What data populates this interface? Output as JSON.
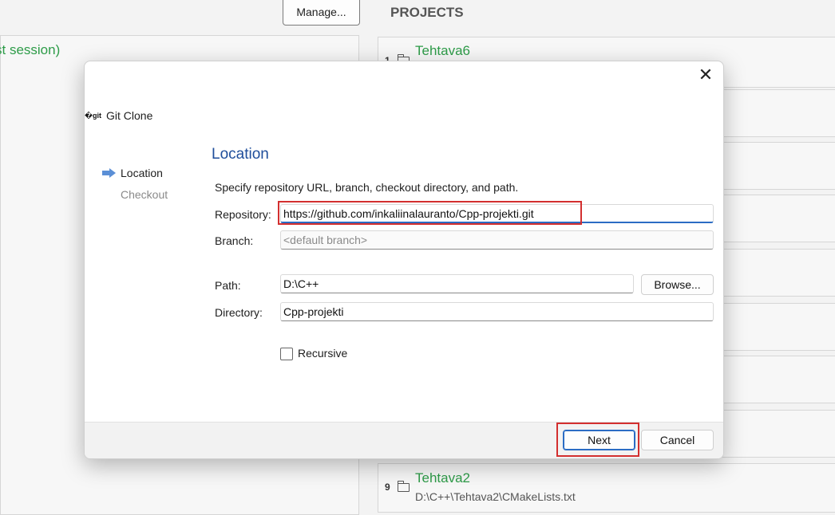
{
  "background": {
    "manage_button": "Manage...",
    "projects_heading": "PROJECTS",
    "session_text": "st session)",
    "projects": [
      {
        "number": "1",
        "name": "Tehtava6",
        "path": ""
      },
      {
        "number": "9",
        "name": "Tehtava2",
        "path": "D:\\C++\\Tehtava2\\CMakeLists.txt"
      }
    ]
  },
  "dialog": {
    "close_glyph": "✕",
    "git_icon_text": "\u0000git",
    "title": "Git Clone",
    "steps": [
      {
        "label": "Location",
        "active": true
      },
      {
        "label": "Checkout",
        "active": false
      }
    ],
    "page_heading": "Location",
    "description": "Specify repository URL, branch, checkout directory, and path.",
    "repository": {
      "label": "Repository:",
      "value": "https://github.com/inkaliinalauranto/Cpp-projekti.git"
    },
    "branch": {
      "label": "Branch:",
      "value": "",
      "placeholder": "<default branch>"
    },
    "path": {
      "label": "Path:",
      "value": "D:\\C++"
    },
    "browse_button": "Browse...",
    "directory": {
      "label": "Directory:",
      "value": "Cpp-projekti"
    },
    "recursive": {
      "label": "Recursive",
      "checked": false
    },
    "next_button": "Next",
    "cancel_button": "Cancel"
  },
  "colors": {
    "accent": "#2b6cc4",
    "heading_blue": "#1f4e9b",
    "highlight_red": "#d32f2f",
    "project_green": "#2e9c49"
  }
}
